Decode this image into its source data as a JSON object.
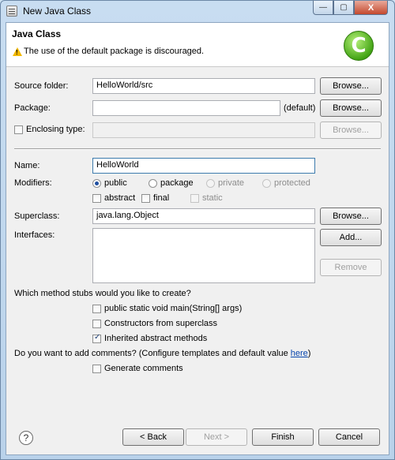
{
  "window": {
    "title": "New Java Class",
    "controls": {
      "minimize": "—",
      "maximize": "▢",
      "close": "X"
    }
  },
  "banner": {
    "title": "Java Class",
    "message": "The use of the default package is discouraged.",
    "icons": {
      "warning": "warning-icon",
      "logo": "java-class-wizard-logo"
    }
  },
  "source_folder": {
    "label": "Source folder:",
    "value": "HelloWorld/src",
    "button": "Browse..."
  },
  "package": {
    "label": "Package:",
    "value": "",
    "suffix": "(default)",
    "button": "Browse..."
  },
  "enclosing_type": {
    "label": "Enclosing type:",
    "checked": false,
    "value": "",
    "button": "Browse..."
  },
  "name": {
    "label": "Name:",
    "value": "HelloWorld"
  },
  "modifiers": {
    "label": "Modifiers:",
    "radios": [
      {
        "label": "public",
        "selected": true,
        "enabled": true
      },
      {
        "label": "package",
        "selected": false,
        "enabled": true
      },
      {
        "label": "private",
        "selected": false,
        "enabled": false
      },
      {
        "label": "protected",
        "selected": false,
        "enabled": false
      }
    ],
    "checks": [
      {
        "label": "abstract",
        "checked": false,
        "enabled": true
      },
      {
        "label": "final",
        "checked": false,
        "enabled": true
      },
      {
        "label": "static",
        "checked": false,
        "enabled": false
      }
    ]
  },
  "superclass": {
    "label": "Superclass:",
    "value": "java.lang.Object",
    "button": "Browse..."
  },
  "interfaces": {
    "label": "Interfaces:",
    "add_button": "Add...",
    "remove_button": "Remove"
  },
  "stubs": {
    "question": "Which method stubs would you like to create?",
    "options": [
      {
        "label": "public static void main(String[] args)",
        "checked": false
      },
      {
        "label": "Constructors from superclass",
        "checked": false
      },
      {
        "label": "Inherited abstract methods",
        "checked": true
      }
    ]
  },
  "comments": {
    "question_prefix": "Do you want to add comments? (Configure templates and default value ",
    "link": "here",
    "question_suffix": ")",
    "option": {
      "label": "Generate comments",
      "checked": false
    }
  },
  "footer": {
    "help": "?",
    "back": "< Back",
    "next": "Next >",
    "finish": "Finish",
    "cancel": "Cancel"
  }
}
